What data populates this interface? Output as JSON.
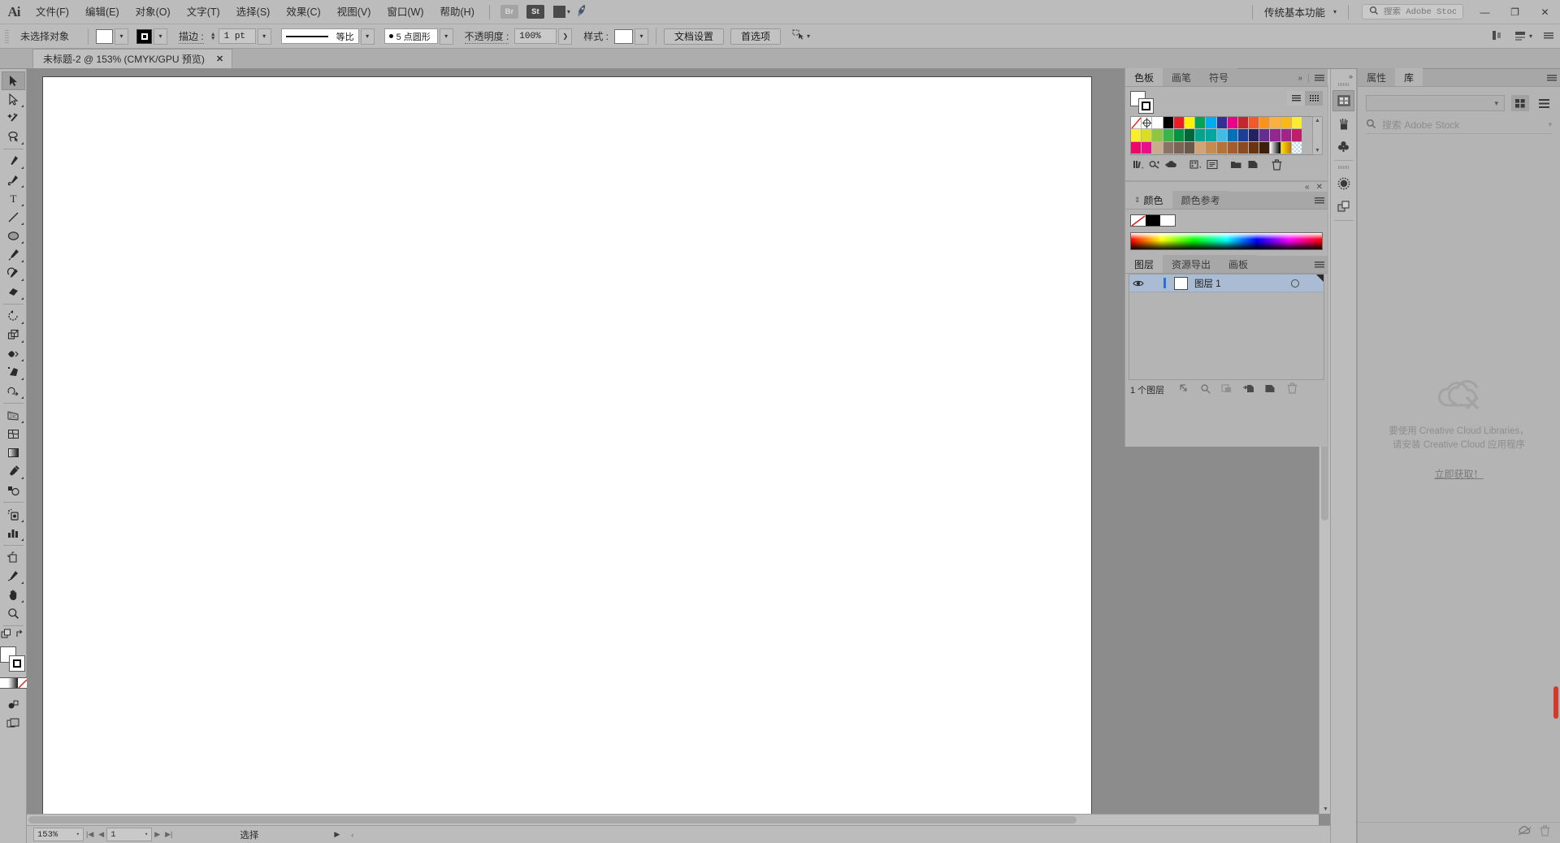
{
  "app": {
    "name": "Adobe Illustrator",
    "logo": "Ai"
  },
  "menubar": {
    "items": [
      {
        "label": "文件(F)",
        "name": "menu-file"
      },
      {
        "label": "编辑(E)",
        "name": "menu-edit"
      },
      {
        "label": "对象(O)",
        "name": "menu-object"
      },
      {
        "label": "文字(T)",
        "name": "menu-type"
      },
      {
        "label": "选择(S)",
        "name": "menu-select"
      },
      {
        "label": "效果(C)",
        "name": "menu-effect"
      },
      {
        "label": "视图(V)",
        "name": "menu-view"
      },
      {
        "label": "窗口(W)",
        "name": "menu-window"
      },
      {
        "label": "帮助(H)",
        "name": "menu-help"
      }
    ],
    "bridge_label": "Br",
    "stock_label": "St",
    "workspace": "传统基本功能",
    "search_placeholder": "搜索 Adobe Stock",
    "search_value": "",
    "window_buttons": {
      "minimize": "—",
      "restore": "❐",
      "close": "✕"
    }
  },
  "controlbar": {
    "selection_status": "未选择对象",
    "stroke_label": "描边 :",
    "stroke_weight": "1 pt",
    "stroke_profile_label": "等比",
    "brush_label": "5 点圆形",
    "opacity_label": "不透明度 :",
    "opacity_value": "100%",
    "style_label": "样式 :",
    "document_setup": "文档设置",
    "preferences": "首选项"
  },
  "tabbar": {
    "document_tab": "未标题-2 @ 153% (CMYK/GPU 预览)",
    "close_glyph": "✕"
  },
  "toolbar": {
    "tools": [
      {
        "name": "selection-tool",
        "label": "选择工具",
        "active": true,
        "group": 1
      },
      {
        "name": "direct-selection-tool",
        "label": "直接选择工具",
        "active": false,
        "group": 1
      },
      {
        "name": "magic-wand-tool",
        "label": "魔棒工具",
        "active": false,
        "group": 1
      },
      {
        "name": "lasso-tool",
        "label": "套索工具",
        "active": false,
        "group": 1
      },
      {
        "name": "pen-tool",
        "label": "钢笔工具",
        "active": false,
        "group": 2
      },
      {
        "name": "curvature-tool",
        "label": "曲率工具",
        "active": false,
        "group": 2
      },
      {
        "name": "type-tool",
        "label": "文字工具",
        "active": false,
        "group": 2
      },
      {
        "name": "line-segment-tool",
        "label": "直线段工具",
        "active": false,
        "group": 2
      },
      {
        "name": "ellipse-tool",
        "label": "椭圆工具",
        "active": false,
        "group": 2
      },
      {
        "name": "paintbrush-tool",
        "label": "画笔工具",
        "active": false,
        "group": 2
      },
      {
        "name": "shaper-tool",
        "label": "Shaper 工具",
        "active": false,
        "group": 2
      },
      {
        "name": "eraser-tool",
        "label": "橡皮擦工具",
        "active": false,
        "group": 2
      },
      {
        "name": "rotate-tool",
        "label": "旋转工具",
        "active": false,
        "group": 3
      },
      {
        "name": "scale-tool",
        "label": "比例缩放工具",
        "active": false,
        "group": 3
      },
      {
        "name": "width-tool",
        "label": "宽度工具",
        "active": false,
        "group": 3
      },
      {
        "name": "free-transform-tool",
        "label": "自由变换工具",
        "active": false,
        "group": 3
      },
      {
        "name": "shape-builder-tool",
        "label": "形状生成器工具",
        "active": false,
        "group": 3
      },
      {
        "name": "perspective-grid-tool",
        "label": "透视网格工具",
        "active": false,
        "group": 4
      },
      {
        "name": "mesh-tool",
        "label": "网格工具",
        "active": false,
        "group": 4
      },
      {
        "name": "gradient-tool",
        "label": "渐变工具",
        "active": false,
        "group": 4
      },
      {
        "name": "eyedropper-tool",
        "label": "吸管工具",
        "active": false,
        "group": 4
      },
      {
        "name": "blend-tool",
        "label": "混合工具",
        "active": false,
        "group": 4
      },
      {
        "name": "symbol-sprayer-tool",
        "label": "符号喷枪工具",
        "active": false,
        "group": 5
      },
      {
        "name": "column-graph-tool",
        "label": "柱形图工具",
        "active": false,
        "group": 5
      },
      {
        "name": "artboard-tool",
        "label": "画板工具",
        "active": false,
        "group": 6
      },
      {
        "name": "slice-tool",
        "label": "切片工具",
        "active": false,
        "group": 6
      },
      {
        "name": "hand-tool",
        "label": "抓手工具",
        "active": false,
        "group": 6
      },
      {
        "name": "zoom-tool",
        "label": "缩放工具",
        "active": false,
        "group": 6
      }
    ],
    "fill_color": "#ffffff",
    "stroke_color": "#000000",
    "color_modes": [
      "color",
      "gradient",
      "none"
    ]
  },
  "canvas": {
    "artboard_background": "#ffffff",
    "canvas_background": "#8c8c8c"
  },
  "statusbar": {
    "zoom_value": "153%",
    "page_value": "1",
    "status_text": "选择"
  },
  "panels": {
    "swatches": {
      "tabs": [
        {
          "label": "色板",
          "active": true,
          "name": "tab-swatches"
        },
        {
          "label": "画笔",
          "active": false,
          "name": "tab-brushes"
        },
        {
          "label": "符号",
          "active": false,
          "name": "tab-symbols"
        }
      ],
      "view_mode": "grid",
      "colors": [
        "none",
        "registration",
        "#ffffff",
        "#000000",
        "#ed1c24",
        "#fff200",
        "#00a651",
        "#00aeef",
        "#2e3192",
        "#ec008c",
        "#c1272d",
        "#f15a29",
        "#f7941e",
        "#fbb040",
        "#fdb913",
        "#f9ed32",
        "#f9ed32",
        "#d7df23",
        "#8dc63f",
        "#39b54a",
        "#009444",
        "#006838",
        "#00a68b",
        "#00a79d",
        "#41bce5",
        "#0072bc",
        "#1b3f94",
        "#262262",
        "#662d91",
        "#92278f",
        "#a3238e",
        "#bf1e6d",
        "#ec0868",
        "#ed0c8c",
        "#c9ac8c",
        "#8c7464",
        "#7c6455",
        "#6b5848",
        "#d4a373",
        "#c68b4e",
        "#b5733a",
        "#a65d2e",
        "#8c4a1f",
        "#6b3410",
        "#3e1f0a",
        "gradient-white",
        "gradient-gold",
        "pattern-blue",
        "pattern-bw",
        "pattern-green",
        "pattern-leaf"
      ],
      "footer_icons": [
        "library-menu-icon",
        "color-group-icon",
        "cloud-swatch-icon",
        "swatch-kinds-icon",
        "swatch-options-icon",
        "new-color-group-icon",
        "new-swatch-icon",
        "delete-swatch-icon"
      ]
    },
    "color": {
      "tabs": [
        {
          "label": "颜色",
          "active": true,
          "name": "tab-color"
        },
        {
          "label": "颜色参考",
          "active": false,
          "name": "tab-color-guide"
        }
      ],
      "swatches": [
        "none",
        "#000000",
        "#ffffff"
      ]
    },
    "layers": {
      "tabs": [
        {
          "label": "图层",
          "active": true,
          "name": "tab-layers"
        },
        {
          "label": "资源导出",
          "active": false,
          "name": "tab-asset-export"
        },
        {
          "label": "画板",
          "active": false,
          "name": "tab-artboards"
        }
      ],
      "rows": [
        {
          "name": "图层 1",
          "visible": true,
          "locked": false,
          "selected": true,
          "color": "#2f6fd0"
        }
      ],
      "count_text": "1 个图层",
      "footer_icons": [
        "locate-object-icon",
        "make-clipping-mask-icon",
        "create-new-sublayer-icon",
        "create-new-layer-icon",
        "delete-selection-icon"
      ]
    },
    "library": {
      "tabs": [
        {
          "label": "属性",
          "active": false,
          "name": "tab-properties"
        },
        {
          "label": "库",
          "active": true,
          "name": "tab-libraries"
        }
      ],
      "library_select_value": "",
      "stock_search_placeholder": "搜索 Adobe Stock",
      "empty_line1": "要使用 Creative Cloud Libraries，",
      "empty_line2": "请安装 Creative Cloud 应用程序",
      "get_now_link": "立即获取！"
    },
    "dock_icons": [
      {
        "name": "swatches-dock-icon",
        "selected": true
      },
      {
        "name": "brushes-dock-icon",
        "selected": false
      },
      {
        "name": "symbols-dock-icon",
        "selected": false
      },
      {
        "name": "color-dock-icon",
        "selected": false
      },
      {
        "name": "layers-dock-icon",
        "selected": false
      }
    ]
  }
}
